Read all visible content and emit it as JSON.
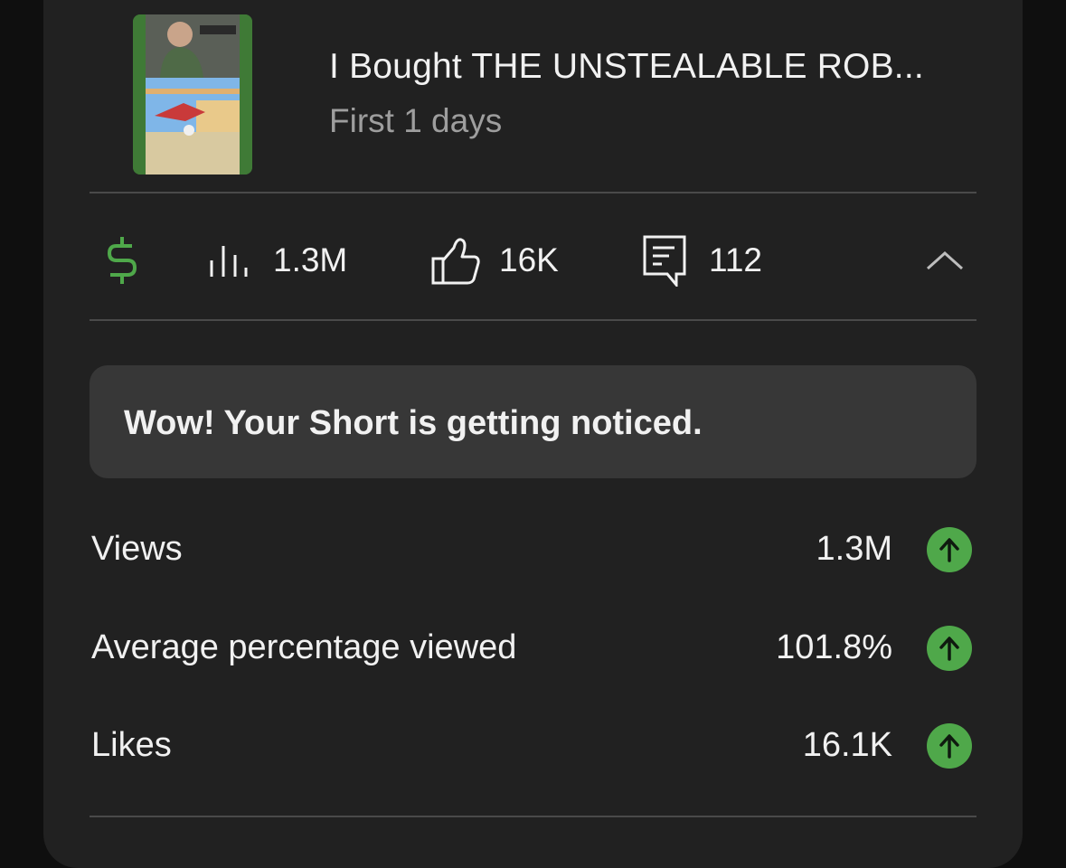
{
  "video": {
    "title": "I Bought THE UNSTEALABLE ROB...",
    "subtitle": "First 1 days",
    "thumbnail_icon": "video-thumbnail"
  },
  "stats": {
    "monetization_icon": "dollar-icon",
    "views": "1.3M",
    "views_icon": "bar-chart-icon",
    "likes": "16K",
    "likes_icon": "thumbs-up-icon",
    "comments": "112",
    "comments_icon": "comment-icon",
    "collapse_icon": "chevron-up-icon"
  },
  "banner": {
    "text": "Wow! Your Short is getting noticed."
  },
  "metrics": [
    {
      "label": "Views",
      "value": "1.3M",
      "trend_icon": "arrow-up-icon"
    },
    {
      "label": "Average percentage viewed",
      "value": "101.8%",
      "trend_icon": "arrow-up-icon"
    },
    {
      "label": "Likes",
      "value": "16.1K",
      "trend_icon": "arrow-up-icon"
    }
  ],
  "colors": {
    "background": "#0f0f0f",
    "card": "#212121",
    "banner": "#373737",
    "accent_green": "#4fa84a",
    "text_primary": "#f1f1f1",
    "text_secondary": "#9e9e9e"
  }
}
